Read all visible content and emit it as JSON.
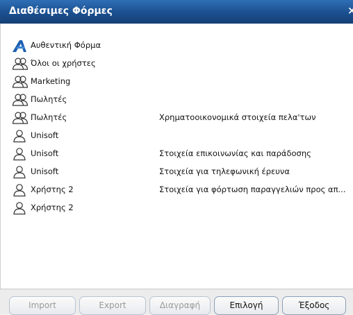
{
  "window": {
    "title": "Διαθέσιμες Φόρμες",
    "close_label": "×"
  },
  "forms": [
    {
      "icon": "authentic-form-icon",
      "name": "Αυθεντική Φόρμα",
      "description": ""
    },
    {
      "icon": "user-group-icon",
      "name": "Όλοι οι χρήστες",
      "description": ""
    },
    {
      "icon": "user-group-icon",
      "name": "Marketing",
      "description": ""
    },
    {
      "icon": "user-group-icon",
      "name": "Πωλητές",
      "description": ""
    },
    {
      "icon": "user-group-icon",
      "name": "Πωλητές",
      "description": "Χρηματοοικονομικά στοιχεία πελα'των"
    },
    {
      "icon": "user-icon",
      "name": "Unisoft",
      "description": ""
    },
    {
      "icon": "user-icon",
      "name": "Unisoft",
      "description": "Στοιχεία επικοινωνίας και παράδοσης"
    },
    {
      "icon": "user-icon",
      "name": "Unisoft",
      "description": "Στοιχεία για τηλεφωνική έρευνα"
    },
    {
      "icon": "user-icon",
      "name": "Χρήστης 2",
      "description": "Στοιχεία για φόρτωση παραγγελιών προς απ..."
    },
    {
      "icon": "user-icon",
      "name": "Χρήστης 2",
      "description": ""
    }
  ],
  "buttons": {
    "import": "Import",
    "export": "Export",
    "delete": "Διαγραφή",
    "select": "Επιλογή",
    "exit": "Έξοδος"
  },
  "colors": {
    "title_bar": "#1b4f8f",
    "icon_blue": "#1f5fb0"
  }
}
